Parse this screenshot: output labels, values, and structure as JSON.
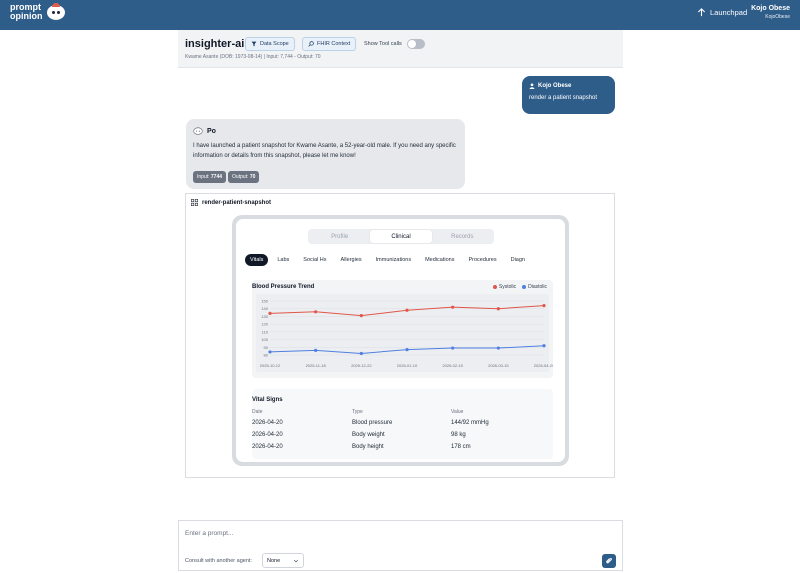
{
  "topbar": {
    "logo_line1": "prompt",
    "logo_line2": "opinion",
    "launchpad_label": "Launchpad",
    "user_name": "Kojo Obese",
    "user_handle": "KojoObese"
  },
  "header": {
    "agent_name": "insighter-ai",
    "data_scope_label": "Data Scope",
    "fhir_context_label": "FHIR Context",
    "tool_calls_label": "Show Tool calls",
    "subinfo": "Kwame Asante (DOB: 1973-08-14) | Input: 7,744 - Output: 70"
  },
  "messages": {
    "user": {
      "author": "Kojo Obese",
      "text": "render a patient snapshot"
    },
    "agent": {
      "author": "Po",
      "text": "I have launched a patient snapshot for Kwame Asante, a 52-year-old male. If you need any specific information or details from this snapshot, please let me know!",
      "input_label": "Input:",
      "input_value": "7744",
      "output_label": "Output:",
      "output_value": "70"
    }
  },
  "tool": {
    "title": "render-patient-snapshot",
    "segments": [
      "Profile",
      "Clinical",
      "Records"
    ],
    "active_segment": "Clinical",
    "tabs": [
      "Vitals",
      "Labs",
      "Social Hx",
      "Allergies",
      "Immunizations",
      "Medications",
      "Procedures",
      "Diagn"
    ],
    "active_tab": "Vitals",
    "vitals": {
      "title": "Vital Signs",
      "headers": [
        "Date",
        "Type",
        "Value"
      ],
      "rows": [
        [
          "2026-04-20",
          "Blood pressure",
          "144/92 mmHg"
        ],
        [
          "2026-04-20",
          "Body weight",
          "98 kg"
        ],
        [
          "2026-04-20",
          "Body height",
          "178 cm"
        ]
      ]
    }
  },
  "chart_data": {
    "type": "line",
    "title": "Blood Pressure Trend",
    "x": [
      "2025-10-12",
      "2025-11-18",
      "2025-12-22",
      "2026-01-10",
      "2026-02-15",
      "2026-03-15",
      "2026-04-20"
    ],
    "series": [
      {
        "name": "Systolic",
        "color": "#e0574a",
        "values": [
          134,
          136,
          131,
          138,
          142,
          140,
          144
        ]
      },
      {
        "name": "Diastolic",
        "color": "#4f7fe0",
        "values": [
          84,
          86,
          82,
          87,
          89,
          89,
          92
        ]
      }
    ],
    "yticks": [
      80,
      90,
      100,
      110,
      120,
      130,
      140,
      150
    ],
    "ylim": [
      80,
      150
    ],
    "grid": true,
    "legend": "top-right"
  },
  "composer": {
    "placeholder": "Enter a prompt...",
    "consult_label": "Consult with another agent:",
    "consult_value": "None"
  },
  "colors": {
    "brand": "#2f5d8a",
    "systolic": "#e0574a",
    "diastolic": "#4f7fe0"
  }
}
